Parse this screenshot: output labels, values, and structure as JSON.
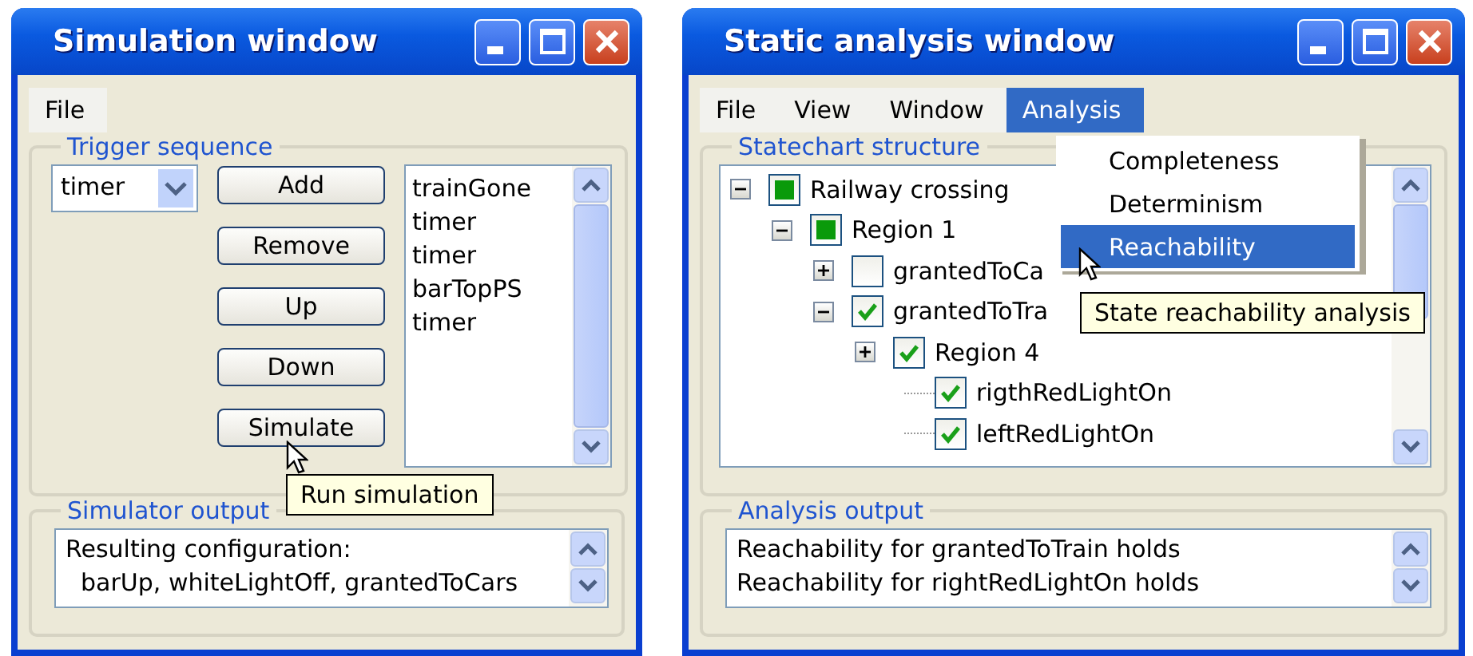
{
  "simulation_window": {
    "title": "Simulation window",
    "menu": [
      {
        "label": "File",
        "selected": false
      }
    ],
    "trigger_sequence": {
      "title": "Trigger sequence",
      "combo": {
        "value": "timer"
      },
      "buttons": [
        "Add",
        "Remove",
        "Up",
        "Down",
        "Simulate"
      ],
      "list": [
        "trainGone",
        "timer",
        "timer",
        "barTopPS",
        "timer"
      ]
    },
    "tooltip": "Run simulation",
    "simulator_output": {
      "title": "Simulator output",
      "lines": [
        "Resulting configuration:",
        "  barUp, whiteLightOff, grantedToCars"
      ]
    }
  },
  "static_analysis_window": {
    "title": "Static analysis window",
    "menu": [
      {
        "label": "File",
        "selected": false
      },
      {
        "label": "View",
        "selected": false
      },
      {
        "label": "Window",
        "selected": false
      },
      {
        "label": "Analysis",
        "selected": true
      }
    ],
    "dropdown": [
      {
        "label": "Completeness",
        "selected": false
      },
      {
        "label": "Determinism",
        "selected": false
      },
      {
        "label": "Reachability",
        "selected": true
      }
    ],
    "tooltip": "State reachability analysis",
    "statechart_structure": {
      "title": "Statechart structure",
      "tree": [
        {
          "label": "Railway crossing",
          "kind": "filled",
          "expanded": true,
          "children": [
            {
              "label": "Region 1",
              "kind": "filled",
              "expanded": true,
              "children": [
                {
                  "label": "grantedToCa",
                  "kind": "checkbox",
                  "checked": false,
                  "expanded": false
                },
                {
                  "label": "grantedToTra",
                  "kind": "checkbox",
                  "checked": true,
                  "expanded": true,
                  "children": [
                    {
                      "label": "Region 4",
                      "kind": "checkbox",
                      "checked": true,
                      "expanded": false,
                      "children": [
                        {
                          "label": "rigthRedLightOn",
                          "kind": "checkbox",
                          "checked": true
                        },
                        {
                          "label": "leftRedLightOn",
                          "kind": "checkbox",
                          "checked": true
                        }
                      ]
                    }
                  ]
                }
              ]
            }
          ]
        }
      ]
    },
    "analysis_output": {
      "title": "Analysis output",
      "lines": [
        "Reachability for grantedToTrain holds",
        "Reachability for rightRedLightOn holds"
      ]
    }
  }
}
